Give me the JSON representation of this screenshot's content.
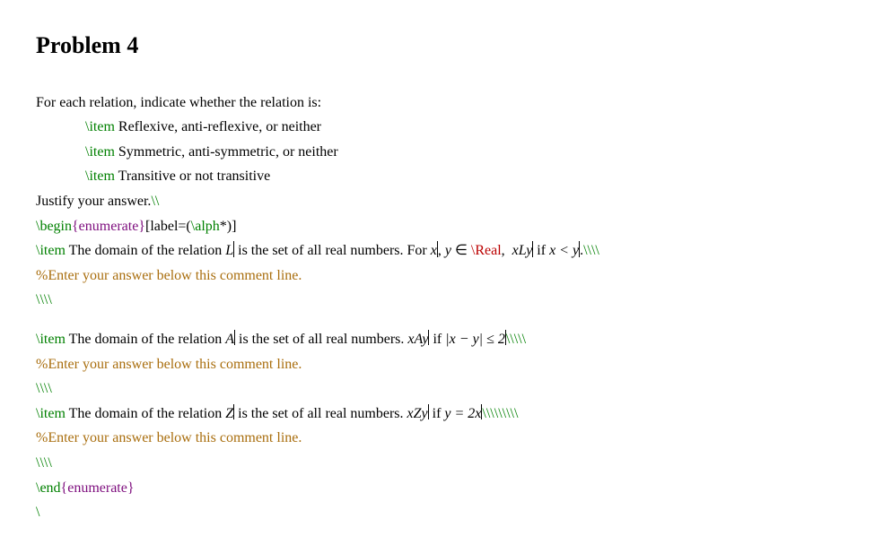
{
  "title": "Problem 4",
  "intro": "For each relation, indicate whether the relation is:",
  "bullets": {
    "b1_cmd": "\\item",
    "b1_text": " Reflexive, anti-reflexive, or neither",
    "b2_cmd": "\\item",
    "b2_text": " Symmetric, anti-symmetric, or neither",
    "b3_cmd": "\\item",
    "b3_text": " Transitive or not transitive"
  },
  "justify": {
    "text": "Justify your answer.",
    "trail": "\\\\"
  },
  "begin_enum": {
    "cmd": "\\begin",
    "arg": "{enumerate}",
    "opt_open": "[label=(",
    "alph_cmd": "\\alph",
    "opt_close": "*)]"
  },
  "itemA": {
    "cmd": "\\item",
    "text1": " The domain of the relation ",
    "math_L": "L",
    "text2": " is the set of all real numbers. For ",
    "math_x": "x",
    "comma1": ", ",
    "math_y": "y",
    "elem": " ∈ ",
    "real_cmd": "\\Real",
    "after_real": ", ",
    "math_xLy": "xLy",
    "iftext": " if ",
    "math_xlty": "x < y",
    "dot": ".",
    "trail": "\\\\\\\\"
  },
  "comment": "%Enter your answer below this comment line.",
  "slashes4": "\\\\\\\\",
  "itemB": {
    "cmd": "\\item",
    "text1": " The domain of the relation ",
    "math_A": "A",
    "text2": " is the set of all real numbers. ",
    "math_xAy": "xAy",
    "iftext": " if ",
    "math_abs": "|x − y| ≤ 2",
    "trail": "\\\\\\\\\\"
  },
  "itemC": {
    "cmd": "\\item",
    "text1": " The domain of the relation ",
    "math_Z": "Z",
    "text2": " is the set of all real numbers. ",
    "math_xZy": "xZy",
    "iftext": " if ",
    "math_eq": "y = 2x",
    "trail": "\\\\\\\\\\\\\\\\\\"
  },
  "end_enum": {
    "cmd": "\\end",
    "arg": "{enumerate}"
  },
  "truncated": "\\"
}
